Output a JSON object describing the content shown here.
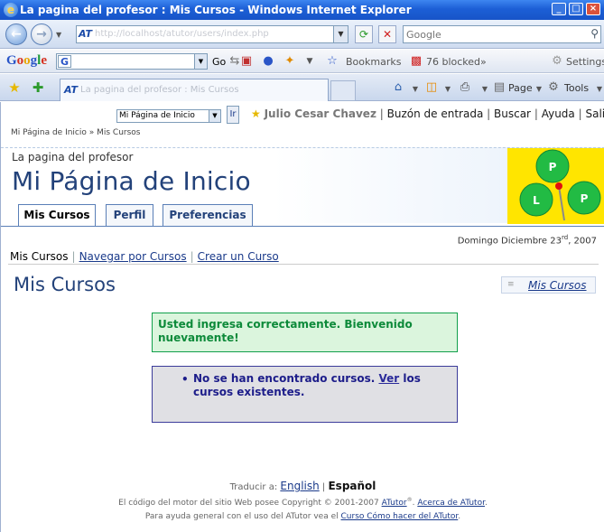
{
  "window": {
    "title": "La pagina del profesor : Mis Cursos - Windows Internet Explorer",
    "minimize": "_",
    "maximize": "□",
    "close": "×"
  },
  "address_bar": {
    "at_label": "AT",
    "url": "http://localhost/atutor/users/index.php",
    "search_placeholder": "Google"
  },
  "google_toolbar": {
    "logo": [
      "G",
      "o",
      "o",
      "g",
      "l",
      "e"
    ],
    "go_label": "Go",
    "bookmarks_label": "Bookmarks",
    "blocked_label": "76 blocked",
    "more_label": "»",
    "settings_label": "Settings"
  },
  "tab_bar": {
    "tab_title": "La pagina del profesor : Mis Cursos",
    "page_label": "Page",
    "tools_label": "Tools"
  },
  "page": {
    "jump_select_value": "Mi Página de Inicio",
    "jump_button": "Ir",
    "user_name": "Julio Cesar Chavez",
    "inbox_link": "Buzón de entrada",
    "search_link": "Buscar",
    "help_link": "Ayuda",
    "logout_link": "Salir",
    "breadcrumb": "Mi Página de Inicio » Mis Cursos",
    "site_subtitle": "La pagina del profesor",
    "site_title": "Mi Página de Inicio",
    "logo": {
      "letters": [
        "P",
        "L",
        "P"
      ],
      "colors": {
        "background": "#ffe500",
        "circle": "#22bb44"
      }
    },
    "tabs": [
      {
        "label": "Mis Cursos",
        "active": true
      },
      {
        "label": "Perfil",
        "active": false
      },
      {
        "label": "Preferencias",
        "active": false
      }
    ],
    "date_prefix": "Domingo Diciembre 23",
    "date_suffix_sup": "rd",
    "date_year": ", 2007",
    "subnav": {
      "current": "Mis Cursos",
      "links": [
        "Navegar por Cursos",
        "Crear un Curso"
      ]
    },
    "heading": "Mis Cursos",
    "quick_link": "Mis Cursos",
    "feedback_success": "Usted ingresa correctamente. Bienvenido nuevamente!",
    "info": {
      "text_before": "No se han encontrado cursos.",
      "link": "Ver",
      "text_after": "los cursos existentes."
    },
    "footer": {
      "translate_label": "Traducir a:",
      "lang_link": "English",
      "lang_current": "Español",
      "copyright_before": "El código del motor del sitio Web posee Copyright © 2001-2007",
      "atutor_link": "ATutor",
      "atutor_sup": "®",
      "about_link": "Acerca de ATutor",
      "help_before": "Para ayuda general con el uso del ATutor vea el",
      "help_link": "Curso Cómo hacer del ATutor"
    }
  }
}
